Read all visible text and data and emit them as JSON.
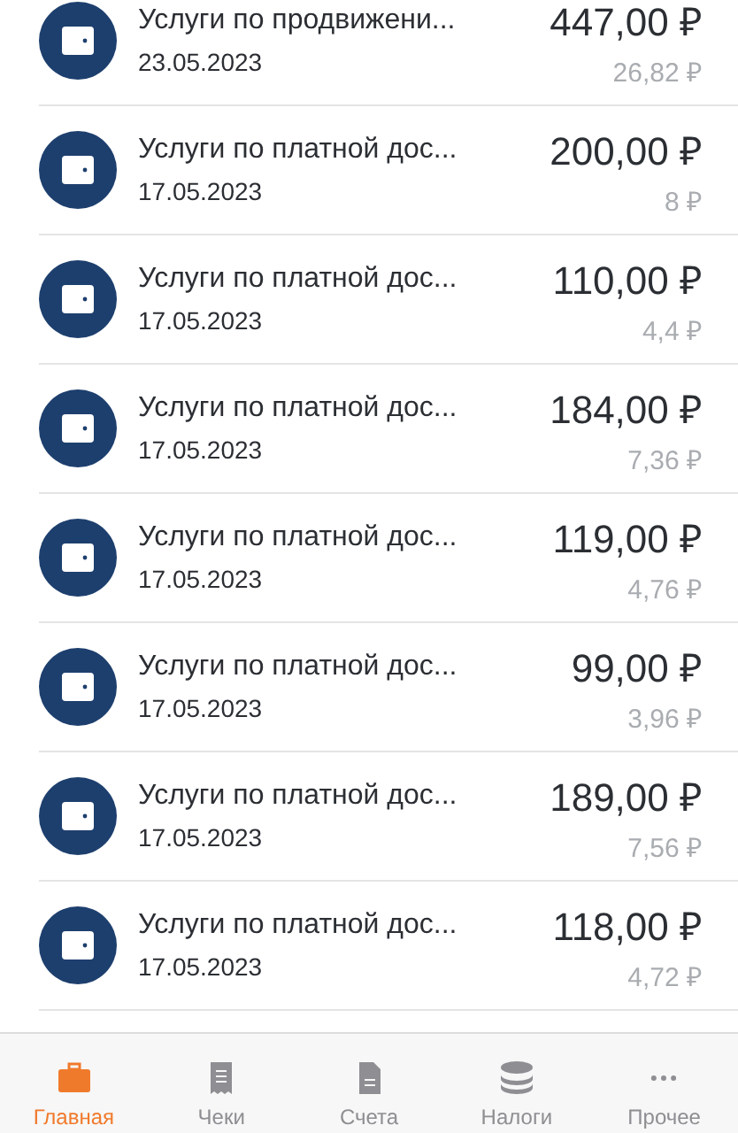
{
  "transactions": [
    {
      "title": "Услуги по продвижени...",
      "date": "23.05.2023",
      "amount": "447,00 ₽",
      "tax": "26,82 ₽"
    },
    {
      "title": "Услуги по платной дос...",
      "date": "17.05.2023",
      "amount": "200,00 ₽",
      "tax": "8 ₽"
    },
    {
      "title": "Услуги по платной дос...",
      "date": "17.05.2023",
      "amount": "110,00 ₽",
      "tax": "4,4 ₽"
    },
    {
      "title": "Услуги по платной дос...",
      "date": "17.05.2023",
      "amount": "184,00 ₽",
      "tax": "7,36 ₽"
    },
    {
      "title": "Услуги по платной дос...",
      "date": "17.05.2023",
      "amount": "119,00 ₽",
      "tax": "4,76 ₽"
    },
    {
      "title": "Услуги по платной дос...",
      "date": "17.05.2023",
      "amount": "99,00 ₽",
      "tax": "3,96 ₽"
    },
    {
      "title": "Услуги по платной дос...",
      "date": "17.05.2023",
      "amount": "189,00 ₽",
      "tax": "7,56 ₽"
    },
    {
      "title": "Услуги по платной дос...",
      "date": "17.05.2023",
      "amount": "118,00 ₽",
      "tax": "4,72 ₽"
    }
  ],
  "tab_bar": [
    {
      "kind": "home",
      "label": "Главная",
      "selected": true
    },
    {
      "kind": "receipts",
      "label": "Чеки",
      "selected": false
    },
    {
      "kind": "invoices",
      "label": "Счета",
      "selected": false
    },
    {
      "kind": "taxes",
      "label": "Налоги",
      "selected": false
    },
    {
      "kind": "more",
      "label": "Прочее",
      "selected": false
    }
  ]
}
